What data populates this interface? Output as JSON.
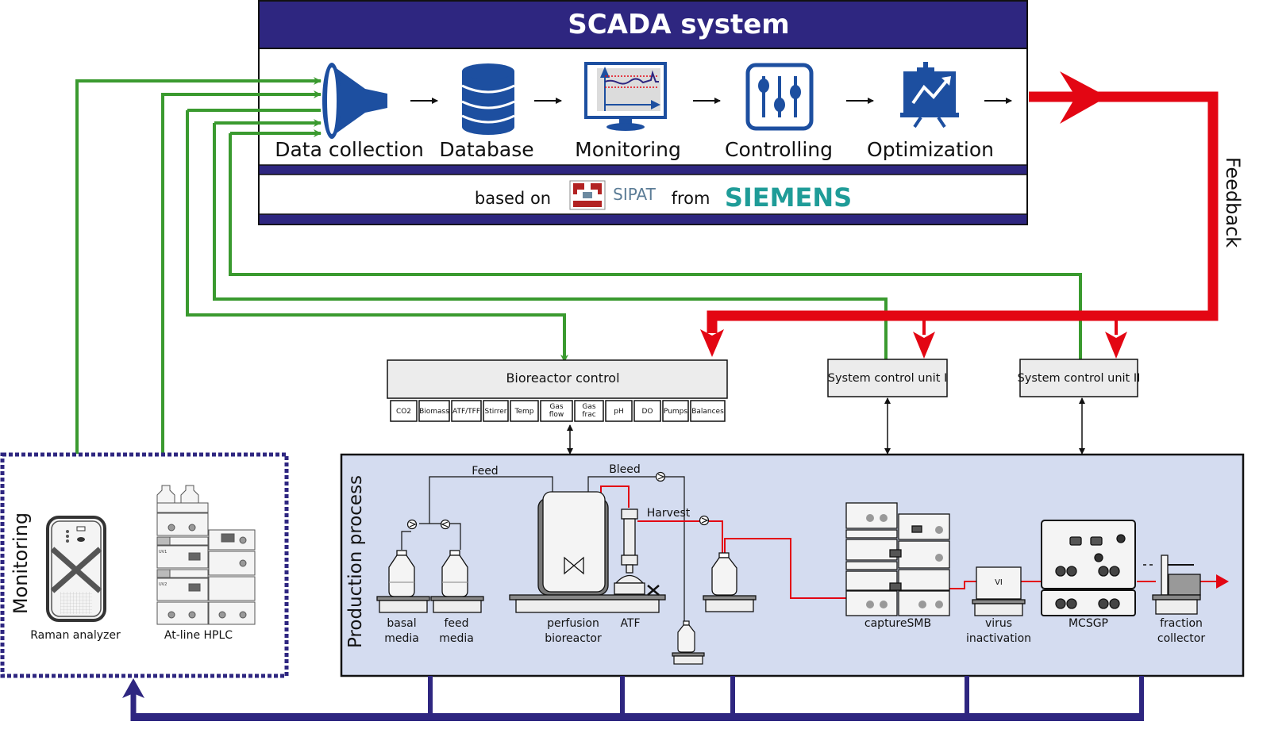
{
  "colors": {
    "navy": "#2e2680",
    "icon_blue": "#1d4fa0",
    "green": "#3a9a2f",
    "red": "#e30613",
    "process_bg": "#d4dcf0",
    "box_fill": "#ececec",
    "siemens_teal": "#1f9c98",
    "sipat_red": "#b22222"
  },
  "scada": {
    "title": "SCADA system",
    "steps": [
      {
        "label": "Data collection",
        "icon": "funnel-icon"
      },
      {
        "label": "Database",
        "icon": "database-icon"
      },
      {
        "label": "Monitoring",
        "icon": "monitor-chart-icon"
      },
      {
        "label": "Controlling",
        "icon": "sliders-icon"
      },
      {
        "label": "Optimization",
        "icon": "presentation-chart-icon"
      }
    ],
    "based_on_label": "based on",
    "sipat_label": "SIPAT",
    "from_label": "from",
    "siemens_label": "SIEMENS"
  },
  "feedback_label": "Feedback",
  "controls": {
    "bioreactor": {
      "title": "Bioreactor control",
      "channels": [
        {
          "line1": "CO2",
          "line2": ""
        },
        {
          "line1": "Biomass",
          "line2": ""
        },
        {
          "line1": "ATF/TFF",
          "line2": ""
        },
        {
          "line1": "Stirrer",
          "line2": ""
        },
        {
          "line1": "Temp",
          "line2": ""
        },
        {
          "line1": "Gas",
          "line2": "flow"
        },
        {
          "line1": "Gas",
          "line2": "frac"
        },
        {
          "line1": "pH",
          "line2": ""
        },
        {
          "line1": "DO",
          "line2": ""
        },
        {
          "line1": "Pumps",
          "line2": ""
        },
        {
          "line1": "Balances",
          "line2": ""
        }
      ]
    },
    "unit1": {
      "title": "System control unit I"
    },
    "unit2": {
      "title": "System control unit II"
    }
  },
  "monitoring": {
    "title": "Monitoring",
    "raman_label": "Raman analyzer",
    "hplc_label": "At-line HPLC",
    "hplc_uv1": "UV1",
    "hplc_uv2": "UV2"
  },
  "process": {
    "title": "Production process",
    "feed_label": "Feed",
    "bleed_label": "Bleed",
    "harvest_label": "Harvest",
    "basal_line1": "basal",
    "basal_line2": "media",
    "feed_line1": "feed",
    "feed_line2": "media",
    "bioreactor_line1": "perfusion",
    "bioreactor_line2": "bioreactor",
    "atf_label": "ATF",
    "capture_label": "captureSMB",
    "vi_box_label": "VI",
    "vi_line1": "virus",
    "vi_line2": "inactivation",
    "mcsgp_label": "MCSGP",
    "fraction_line1": "fraction",
    "fraction_line2": "collector"
  }
}
